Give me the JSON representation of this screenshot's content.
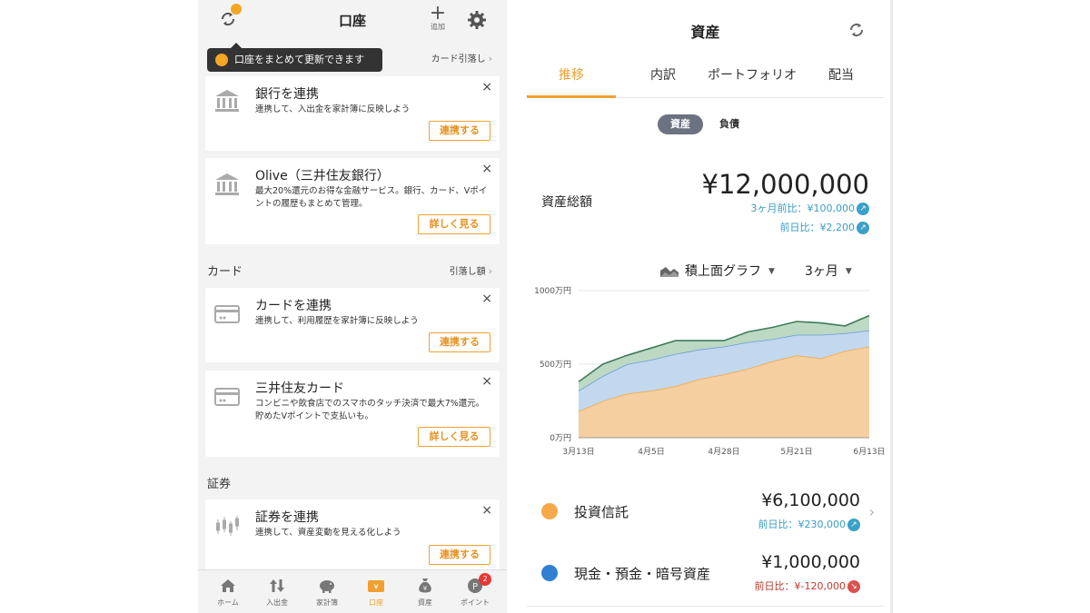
{
  "left": {
    "title": "口座",
    "add_label": "追加",
    "tooltip": "口座をまとめて更新できます",
    "bank_section_link": "カード引落し",
    "card_section_title": "カード",
    "card_section_link": "引落し額",
    "securities_section_title": "証券",
    "cards": [
      {
        "title": "銀行を連携",
        "desc": "連携して、入出金を家計簿に反映しよう",
        "button": "連携する",
        "close": "×"
      },
      {
        "title": "Olive（三井住友銀行）",
        "desc": "最大20%還元のお得な金融サービス。銀行、カード、Vポイントの履歴もまとめて管理。",
        "button": "詳しく見る",
        "close": "×"
      },
      {
        "title": "カードを連携",
        "desc": "連携して、利用履歴を家計簿に反映しよう",
        "button": "連携する",
        "close": "×"
      },
      {
        "title": "三井住友カード",
        "desc": "コンビニや飲食店でのスマホのタッチ決済で最大7%還元。貯めたVポイントで支払いも。",
        "button": "詳しく見る",
        "close": "×"
      },
      {
        "title": "証券を連携",
        "desc": "連携して、資産変動を見える化しよう",
        "button": "連携する",
        "close": "×"
      }
    ],
    "nav": [
      {
        "label": "ホーム",
        "icon": "home-icon"
      },
      {
        "label": "入出金",
        "icon": "transfer-icon"
      },
      {
        "label": "家計簿",
        "icon": "piggy-bank-icon"
      },
      {
        "label": "口座",
        "icon": "account-icon"
      },
      {
        "label": "資産",
        "icon": "money-bag-icon"
      },
      {
        "label": "ポイント",
        "icon": "point-icon"
      }
    ],
    "points_badge": "2",
    "accent": "#f0a030"
  },
  "right": {
    "title": "資産",
    "tabs": [
      "推移",
      "内訳",
      "ポートフォリオ",
      "配当"
    ],
    "segments": [
      "資産",
      "負債"
    ],
    "total_label": "資産総額",
    "total_value": "¥12,000,000",
    "change_3m": "3ヶ月前比：¥100,000",
    "change_day": "前日比：¥2,200",
    "chart_type_label": "積上面グラフ",
    "period_label": "3ヶ月",
    "items": [
      {
        "name": "投資信託",
        "amount": "¥6,100,000",
        "change": "前日比：¥230,000",
        "color": "#f5a94a",
        "direction": "up"
      },
      {
        "name": "現金・預金・暗号資産",
        "amount": "¥1,000,000",
        "change": "前日比：¥-120,000",
        "color": "#2f80d1",
        "direction": "down"
      }
    ]
  },
  "chart_data": {
    "type": "area",
    "stacked": true,
    "x": [
      "3月13日",
      "3月20日",
      "3月27日",
      "4月5日",
      "4月12日",
      "4月20日",
      "4月28日",
      "5月6日",
      "5月14日",
      "5月21日",
      "5月29日",
      "6月6日",
      "6月13日"
    ],
    "ytick_labels": [
      "0万円",
      "500万円",
      "1000万円"
    ],
    "ylim": [
      0,
      1000
    ],
    "xtick_labels": [
      "3月13日",
      "4月5日",
      "4月28日",
      "5月21日",
      "6月13日"
    ],
    "series": [
      {
        "values": [
          180,
          250,
          300,
          320,
          350,
          400,
          430,
          470,
          520,
          560,
          540,
          590,
          620
        ],
        "color": "#f5cfa0",
        "line": "#f5a94a"
      },
      {
        "values": [
          140,
          170,
          200,
          210,
          220,
          200,
          190,
          180,
          150,
          140,
          160,
          120,
          110
        ],
        "color": "#c2d8ef",
        "line": "#6a9ad6"
      },
      {
        "values": [
          60,
          80,
          60,
          80,
          90,
          60,
          40,
          70,
          80,
          90,
          80,
          50,
          100
        ],
        "color": "#bcd9c4",
        "line": "#3f7b58"
      }
    ],
    "grid": true
  }
}
